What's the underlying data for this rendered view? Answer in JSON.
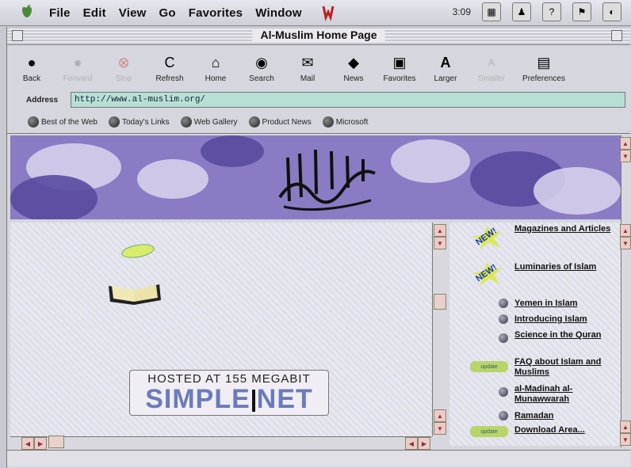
{
  "menubar": {
    "menus": [
      "File",
      "Edit",
      "View",
      "Go",
      "Favorites",
      "Window"
    ],
    "clock": "3:09"
  },
  "window": {
    "title": "Al-Muslim Home Page"
  },
  "toolbar": {
    "buttons": [
      {
        "label": "Back",
        "icon": "back-arrow-icon",
        "enabled": true
      },
      {
        "label": "Forward",
        "icon": "forward-arrow-icon",
        "enabled": false
      },
      {
        "label": "Stop",
        "icon": "stop-icon",
        "enabled": false
      },
      {
        "label": "Refresh",
        "icon": "refresh-icon",
        "enabled": true
      },
      {
        "label": "Home",
        "icon": "home-icon",
        "enabled": true
      },
      {
        "label": "Search",
        "icon": "search-icon",
        "enabled": true
      },
      {
        "label": "Mail",
        "icon": "mail-icon",
        "enabled": true
      },
      {
        "label": "News",
        "icon": "news-icon",
        "enabled": true
      },
      {
        "label": "Favorites",
        "icon": "favorites-icon",
        "enabled": true
      },
      {
        "label": "Larger",
        "icon": "larger-text-icon",
        "enabled": true
      },
      {
        "label": "Smaller",
        "icon": "smaller-text-icon",
        "enabled": false
      },
      {
        "label": "Preferences",
        "icon": "preferences-icon",
        "enabled": true
      }
    ]
  },
  "address": {
    "label": "Address",
    "value": "http://www.al-muslim.org/"
  },
  "links": [
    "Best of the Web",
    "Today's Links",
    "Web Gallery",
    "Product News",
    "Microsoft"
  ],
  "page": {
    "hosted_line1": "HOSTED AT 155 MEGABIT",
    "hosted_brand_left": "SIMPLE",
    "hosted_brand_right": "NET"
  },
  "sidebar": {
    "items": [
      {
        "label": "Magazines and Articles",
        "badge": "NEW!"
      },
      {
        "label": "Luminaries of Islam",
        "badge": "NEW!"
      },
      {
        "label": "Yemen in Islam"
      },
      {
        "label": "Introducing Islam"
      },
      {
        "label": "Science in the Quran"
      },
      {
        "label": "FAQ about Islam and Muslims",
        "badge": "update"
      },
      {
        "label": "al-Madinah al-Munawwarah"
      },
      {
        "label": "Ramadan"
      },
      {
        "label": "Download Area...",
        "badge": "update"
      }
    ]
  },
  "colors": {
    "banner": "#8a7bc4",
    "address_bg": "#b7dfd6",
    "brand_blue": "#6c7bb8"
  }
}
